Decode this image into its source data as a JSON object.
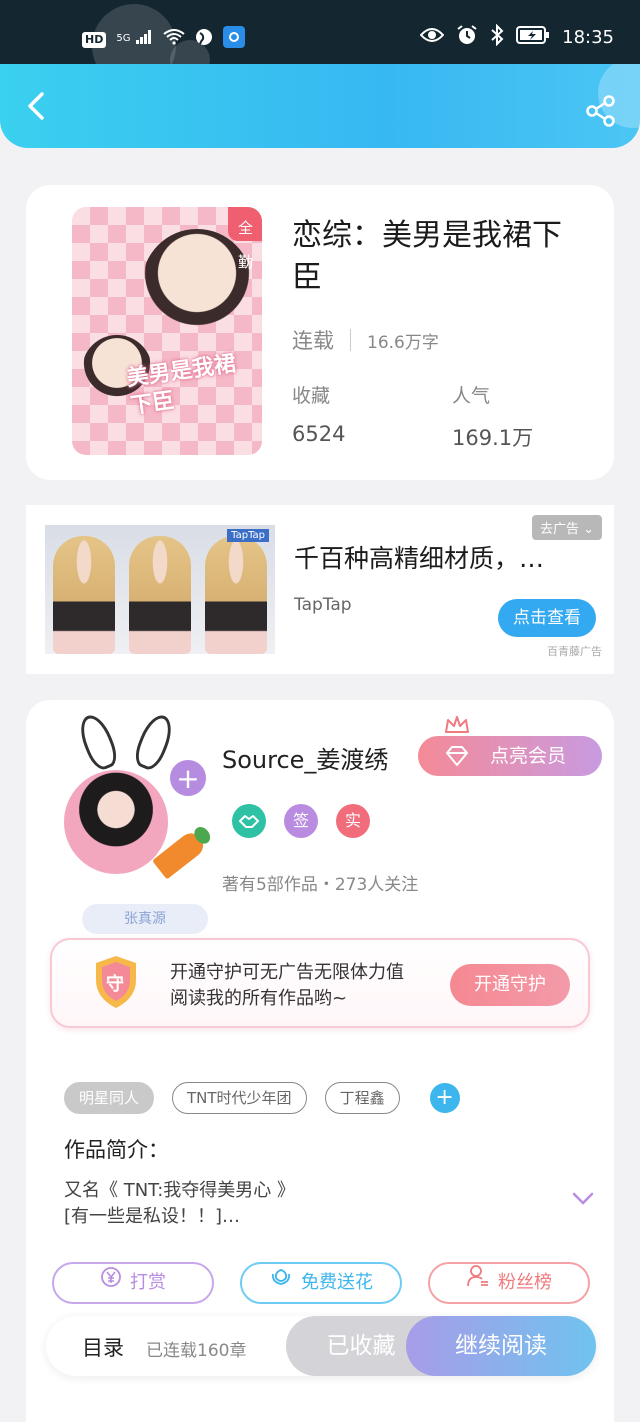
{
  "status_bar": {
    "hd": "HD",
    "network": "5G",
    "time": "18:35"
  },
  "header": {
    "back_icon": "chevron-left-icon",
    "share_icon": "share-icon"
  },
  "book": {
    "badge": "全勤",
    "title": "恋综：美男是我裙下臣",
    "status": "连载",
    "word_count": "16.6万字",
    "stats": [
      {
        "label": "收藏",
        "value": "6524"
      },
      {
        "label": "人气",
        "value": "169.1万"
      }
    ],
    "cover_art_text": "美男是我裙下臣"
  },
  "ad": {
    "image_tag": "TapTap",
    "headline": "千百种高精细材质，…",
    "source": "TapTap",
    "close_label": "去广告 ⌄",
    "cta_label": "点击查看",
    "provider": "百青藤广告"
  },
  "author": {
    "name": "Source_姜渡绣",
    "avatar_tag": "张真源",
    "vip_label": "点亮会员",
    "badges": [
      {
        "label": "",
        "icon": "handshake-icon",
        "color": "#2fc1a4"
      },
      {
        "label": "签",
        "color": "#b98ce1"
      },
      {
        "label": "实",
        "color": "#f26d7b"
      }
    ],
    "stats": "著有5部作品・273人关注",
    "guard_shield": "守",
    "guard_text_line1": "开通守护可无广告无限体力值",
    "guard_text_line2": "阅读我的所有作品哟~",
    "guard_button": "开通守护",
    "tags": [
      "明星同人",
      "TNT时代少年团",
      "丁程鑫"
    ],
    "intro_title": "作品简介：",
    "intro_line1": "又名《 TNT:我夺得美男心 》",
    "intro_line2": "[有一些是私设！！]…",
    "actions": [
      {
        "label": "打赏",
        "icon": "yen-icon",
        "color": "#b98ce1"
      },
      {
        "label": "免费送花",
        "icon": "flower-icon",
        "color": "#3db6ee"
      },
      {
        "label": "粉丝榜",
        "icon": "person-icon",
        "color": "#f07a7f"
      }
    ]
  },
  "bottom_bar": {
    "toc_label": "目录",
    "chapters": "已连载160章",
    "collected_label": "已收藏",
    "read_label": "继续阅读"
  },
  "colors": {
    "header_gradient_start": "#3ad0ef",
    "header_gradient_end": "#37b8f2",
    "accent_pink": "#f58a97",
    "accent_purple": "#b58ce0",
    "accent_blue": "#33a9f1"
  }
}
